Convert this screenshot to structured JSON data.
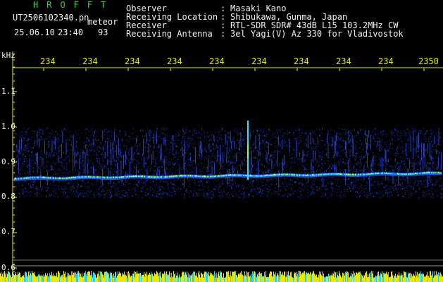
{
  "header": {
    "brand": "HROFFT",
    "filename": "UT2506102340.pn",
    "mode": "meteor",
    "date": "25.06.10",
    "time": "23:40",
    "count": "93",
    "fields": [
      {
        "label": "Observer",
        "value": "Masaki Kano"
      },
      {
        "label": "Receiving Location",
        "value": "Shibukawa, Gunma, Japan"
      },
      {
        "label": "Receiver",
        "value": "RTL-SDR SDR# 43dB L15 103.2MHz CW"
      },
      {
        "label": "Receiving Antenna",
        "value": "3el Yagi(V) Az 330 for Vladivostok"
      }
    ]
  },
  "axis": {
    "unit": "kHz",
    "y_ticks": [
      "1.1",
      "1.0",
      "0.9",
      "0.8",
      "0.7",
      "0.6"
    ],
    "x_ticks": [
      "234",
      "234",
      "234",
      "234",
      "234",
      "234",
      "234",
      "234",
      "234",
      "2350"
    ]
  },
  "colors": {
    "text": "#f2f2f2",
    "brand": "#39d639",
    "ticks": "#e8e800",
    "axis": "#e8e800"
  }
}
